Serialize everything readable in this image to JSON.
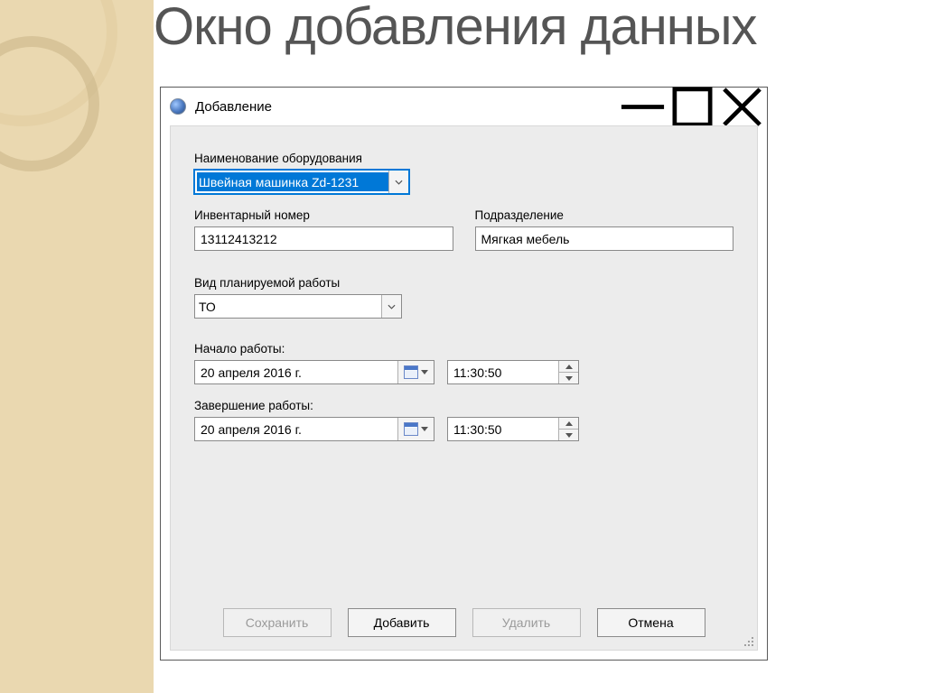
{
  "slide": {
    "title": "Окно добавления данных"
  },
  "window": {
    "title": "Добавление",
    "controls": {
      "min": "—",
      "max": "☐",
      "close": "✕"
    }
  },
  "fields": {
    "equipment": {
      "label": "Наименование оборудования",
      "value": "Швейная машинка Zd-1231"
    },
    "inventory": {
      "label": "Инвентарный номер",
      "value": "13112413212"
    },
    "department": {
      "label": "Подразделение",
      "value": "Мягкая мебель"
    },
    "worktype": {
      "label": "Вид планируемой работы",
      "value": "ТО"
    },
    "start": {
      "label": "Начало работы:",
      "date": "20  апреля  2016 г.",
      "time": "11:30:50"
    },
    "end": {
      "label": "Завершение работы:",
      "date": "20  апреля  2016 г.",
      "time": "11:30:50"
    }
  },
  "buttons": {
    "save": "Сохранить",
    "add": "Добавить",
    "delete": "Удалить",
    "cancel": "Отмена"
  }
}
